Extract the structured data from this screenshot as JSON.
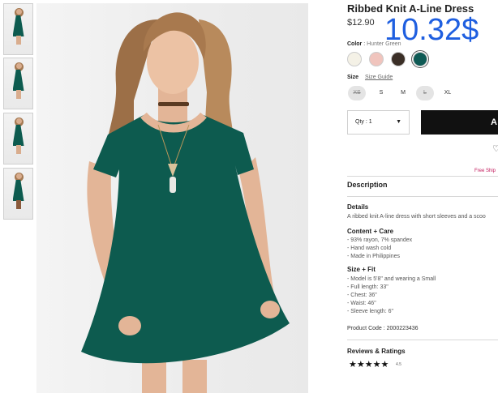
{
  "product": {
    "title": "Ribbed Knit A-Line Dress",
    "price": "$12.90",
    "overlay_price": "10.32$"
  },
  "color": {
    "label": "Color",
    "selected": "Hunter Green",
    "swatches": [
      {
        "name": "cream",
        "hex": "#f4f1e6"
      },
      {
        "name": "blush",
        "hex": "#f0c4bd"
      },
      {
        "name": "brown",
        "hex": "#3b2f27"
      },
      {
        "name": "hunter-green",
        "hex": "#0f5a55"
      }
    ]
  },
  "size": {
    "label": "Size",
    "guide": "Size Guide",
    "options": [
      "XS",
      "S",
      "M",
      "L",
      "XL"
    ]
  },
  "purchase": {
    "qty": "Qty : 1",
    "add_label": "A",
    "free_shipping": "Free Ship"
  },
  "description": {
    "heading": "Description",
    "details_h": "Details",
    "details_text": "A ribbed knit A-line dress with short sleeves and a scoo",
    "care_h": "Content + Care",
    "care": [
      "- 93% rayon, 7% spandex",
      "- Hand wash cold",
      "- Made in Philippines"
    ],
    "fit_h": "Size + Fit",
    "fit": [
      "- Model is 5'8\" and wearing a Small",
      "- Full length: 33\"",
      "- Chest: 36\"",
      "- Waist: 46\"",
      "- Sleeve length: 6\""
    ],
    "product_code": "Product Code : 2000223436"
  },
  "reviews": {
    "heading": "Reviews & Ratings",
    "stars": "★★★★★",
    "rating": "4.5"
  },
  "colors": {
    "dress": "#0d5b4f",
    "accent_blue": "#1f5fe0",
    "button": "#111111"
  },
  "icons": [
    "heart-icon",
    "caret-down-icon",
    "star-icon"
  ]
}
